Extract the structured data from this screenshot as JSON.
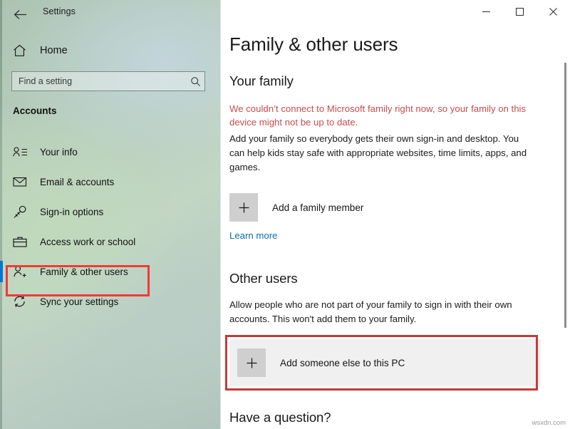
{
  "window": {
    "app_title": "Settings",
    "back_icon": "back-arrow-icon",
    "controls": {
      "minimize": "─",
      "maximize": "☐",
      "close": "✕"
    }
  },
  "sidebar": {
    "home_label": "Home",
    "home_icon": "home-icon",
    "search": {
      "placeholder": "Find a setting",
      "value": "",
      "icon": "search-icon"
    },
    "section_label": "Accounts",
    "items": [
      {
        "label": "Your info",
        "icon": "person-info-icon",
        "selected": false
      },
      {
        "label": "Email & accounts",
        "icon": "envelope-icon",
        "selected": false
      },
      {
        "label": "Sign-in options",
        "icon": "key-icon",
        "selected": false
      },
      {
        "label": "Access work or school",
        "icon": "briefcase-icon",
        "selected": false
      },
      {
        "label": "Family & other users",
        "icon": "person-add-icon",
        "selected": true
      },
      {
        "label": "Sync your settings",
        "icon": "sync-icon",
        "selected": false
      }
    ],
    "accent_color": "#0078d7",
    "highlight_color": "#ef3a3a"
  },
  "main": {
    "page_title": "Family & other users",
    "your_family": {
      "heading": "Your family",
      "warning": "We couldn’t connect to Microsoft family right now, so your family on this device might not be up to date.",
      "warning_color": "#c84c4c",
      "description": "Add your family so everybody gets their own sign-in and desktop. You can help kids stay safe with appropriate websites, time limits, apps, and games.",
      "add_button": {
        "label": "Add a family member",
        "icon": "plus-icon"
      },
      "learn_more": "Learn more",
      "link_color": "#0b6ab0"
    },
    "other_users": {
      "heading": "Other users",
      "description": "Allow people who are not part of your family to sign in with their own accounts. This won't add them to your family.",
      "add_button": {
        "label": "Add someone else to this PC",
        "icon": "plus-icon"
      },
      "highlight_color": "#c23b3b"
    },
    "have_question_heading": "Have a question?"
  },
  "watermark": "wsxdn.com"
}
